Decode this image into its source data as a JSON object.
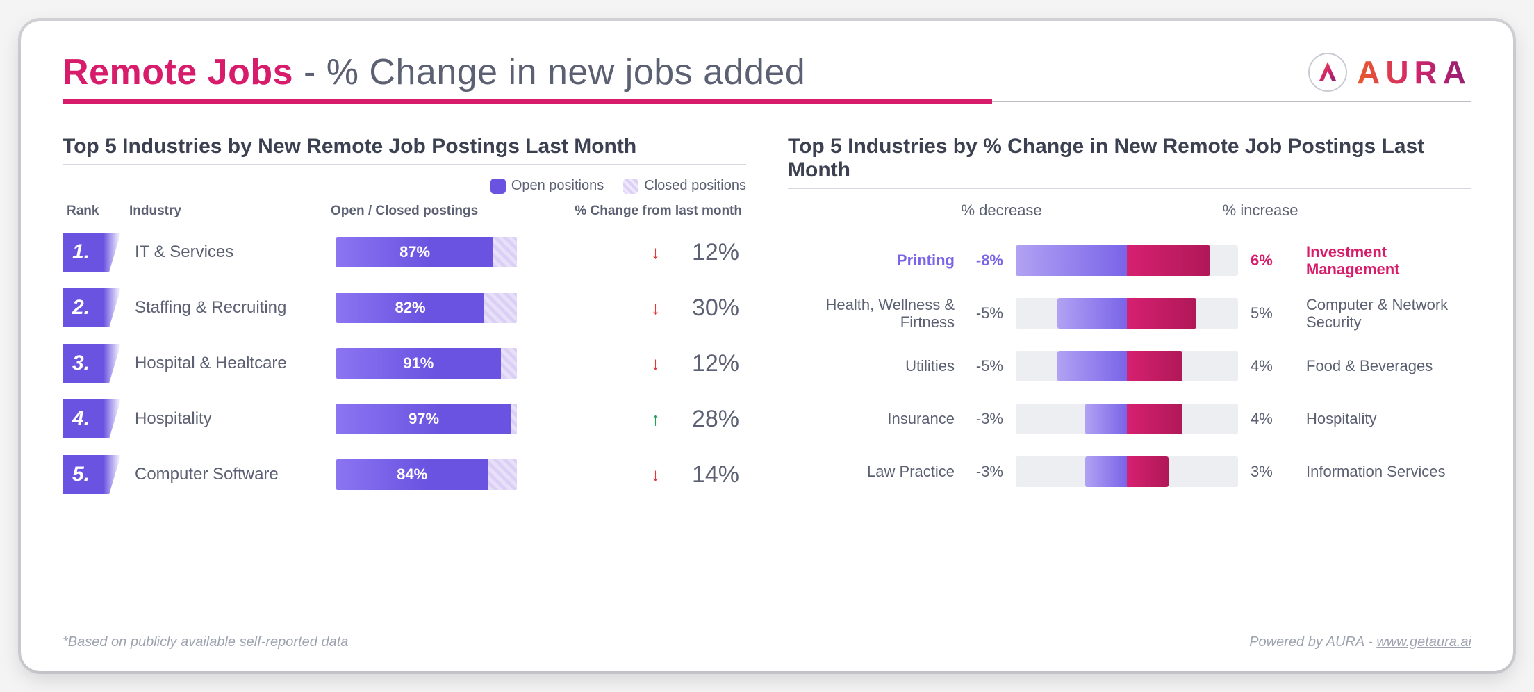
{
  "header": {
    "title_strong": "Remote Jobs",
    "title_rest": " - % Change in new jobs added",
    "brand": "AURA"
  },
  "left": {
    "title": "Top 5 Industries by New Remote Job Postings Last Month",
    "legend": {
      "open": "Open positions",
      "closed": "Closed positions"
    },
    "columns": {
      "rank": "Rank",
      "industry": "Industry",
      "postings": "Open / Closed postings",
      "change": "% Change from last month"
    },
    "rows": [
      {
        "rank": "1.",
        "industry": "IT & Services",
        "open_pct": 87,
        "open_label": "87%",
        "dir": "down",
        "change": "12%"
      },
      {
        "rank": "2.",
        "industry": "Staffing & Recruiting",
        "open_pct": 82,
        "open_label": "82%",
        "dir": "down",
        "change": "30%"
      },
      {
        "rank": "3.",
        "industry": "Hospital & Healtcare",
        "open_pct": 91,
        "open_label": "91%",
        "dir": "down",
        "change": "12%"
      },
      {
        "rank": "4.",
        "industry": "Hospitality",
        "open_pct": 97,
        "open_label": "97%",
        "dir": "up",
        "change": "28%"
      },
      {
        "rank": "5.",
        "industry": "Computer Software",
        "open_pct": 84,
        "open_label": "84%",
        "dir": "down",
        "change": "14%"
      }
    ]
  },
  "right": {
    "title": "Top 5 Industries by % Change in New Remote Job Postings Last Month",
    "headers": {
      "decrease": "% decrease",
      "increase": "% increase"
    },
    "scale_max": 8,
    "rows": [
      {
        "dec_label": "Printing",
        "dec_val": -8,
        "dec_text": "-8%",
        "inc_val": 6,
        "inc_text": "6%",
        "inc_label": "Investment Management"
      },
      {
        "dec_label": "Health, Wellness & Firtness",
        "dec_val": -5,
        "dec_text": "-5%",
        "inc_val": 5,
        "inc_text": "5%",
        "inc_label": "Computer & Network Security"
      },
      {
        "dec_label": "Utilities",
        "dec_val": -5,
        "dec_text": "-5%",
        "inc_val": 4,
        "inc_text": "4%",
        "inc_label": "Food & Beverages"
      },
      {
        "dec_label": "Insurance",
        "dec_val": -3,
        "dec_text": "-3%",
        "inc_val": 4,
        "inc_text": "4%",
        "inc_label": "Hospitality"
      },
      {
        "dec_label": "Law Practice",
        "dec_val": -3,
        "dec_text": "-3%",
        "inc_val": 3,
        "inc_text": "3%",
        "inc_label": "Information Services"
      }
    ]
  },
  "footer": {
    "note": "*Based on publicly available self-reported data",
    "powered_prefix": "Powered by AURA - ",
    "url": "www.getaura.ai"
  },
  "chart_data": [
    {
      "type": "bar",
      "title": "Top 5 Industries by New Remote Job Postings Last Month",
      "categories": [
        "IT & Services",
        "Staffing & Recruiting",
        "Hospital & Healtcare",
        "Hospitality",
        "Computer Software"
      ],
      "series": [
        {
          "name": "Open positions (%)",
          "values": [
            87,
            82,
            91,
            97,
            84
          ]
        },
        {
          "name": "Closed positions (%)",
          "values": [
            13,
            18,
            9,
            3,
            16
          ]
        }
      ],
      "aux": {
        "pct_change_from_last_month": [
          -12,
          -30,
          -12,
          28,
          -14
        ]
      },
      "xlabel": "Open / Closed postings",
      "ylabel": "Industry",
      "xlim": [
        0,
        100
      ]
    },
    {
      "type": "bar",
      "title": "Top 5 Industries by % Change in New Remote Job Postings Last Month",
      "orientation": "diverging",
      "series": [
        {
          "name": "% decrease",
          "categories": [
            "Printing",
            "Health, Wellness & Firtness",
            "Utilities",
            "Insurance",
            "Law Practice"
          ],
          "values": [
            -8,
            -5,
            -5,
            -3,
            -3
          ]
        },
        {
          "name": "% increase",
          "categories": [
            "Investment Management",
            "Computer & Network Security",
            "Food & Beverages",
            "Hospitality",
            "Information Services"
          ],
          "values": [
            6,
            5,
            4,
            4,
            3
          ]
        }
      ],
      "xlim": [
        -8,
        8
      ]
    }
  ]
}
